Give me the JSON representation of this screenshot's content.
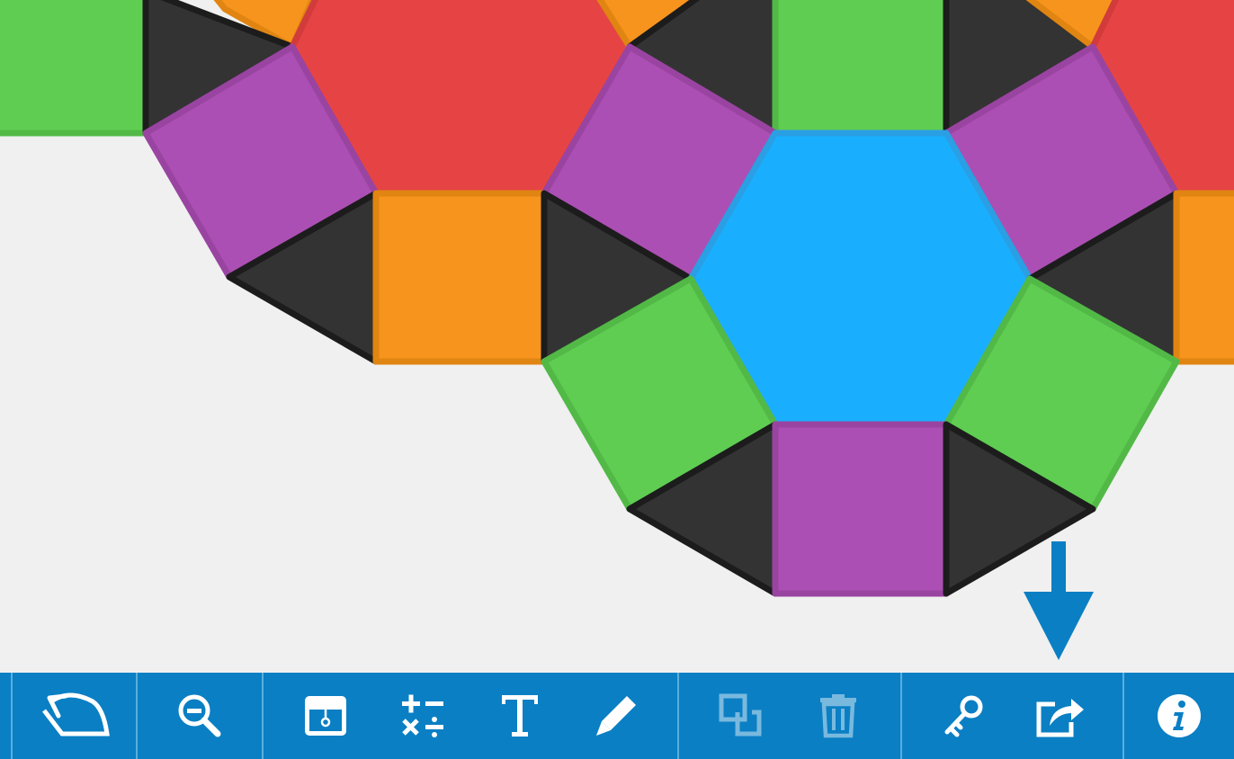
{
  "canvas": {
    "tile_colors": {
      "triangle": "#333333",
      "triangle_border": "#1c1c1c",
      "square_orange": "#f7941d",
      "square_green": "#5fcd52",
      "square_purple": "#ac4fb4",
      "hexagon_red": "#e64444",
      "hexagon_blue": "#1aaffe"
    }
  },
  "hint_arrow": {
    "color": "#0a7fc4",
    "points_to": "share-button"
  },
  "toolbar": {
    "background": "#0a7fc4",
    "divider_color": "#5aaede",
    "buttons": [
      {
        "name": "undo-button",
        "icon": "undo-icon",
        "enabled": true
      },
      {
        "name": "zoom-out-button",
        "icon": "zoom-out-icon",
        "enabled": true
      },
      {
        "name": "background-button",
        "icon": "background-icon",
        "enabled": true
      },
      {
        "name": "calculator-button",
        "icon": "math-operators-icon",
        "enabled": true
      },
      {
        "name": "text-button",
        "icon": "text-icon",
        "enabled": true
      },
      {
        "name": "pen-button",
        "icon": "pencil-icon",
        "enabled": true
      },
      {
        "name": "duplicate-button",
        "icon": "duplicate-icon",
        "enabled": false
      },
      {
        "name": "delete-button",
        "icon": "trash-icon",
        "enabled": false
      },
      {
        "name": "key-button",
        "icon": "key-icon",
        "enabled": true
      },
      {
        "name": "share-button",
        "icon": "share-icon",
        "enabled": true
      },
      {
        "name": "info-button",
        "icon": "info-icon",
        "enabled": true
      }
    ]
  }
}
